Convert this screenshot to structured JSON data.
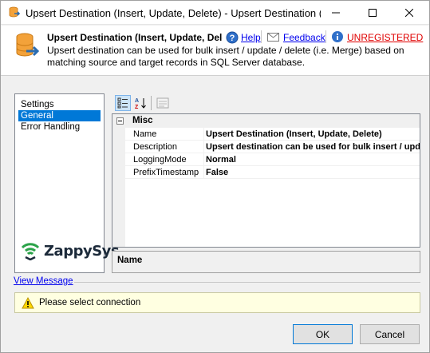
{
  "window": {
    "title": "Upsert Destination (Insert, Update, Delete) - Upsert Destination (Insert, Update, Delete)",
    "minimize_glyph": "—",
    "maximize_glyph": "☐",
    "close_glyph": "✕"
  },
  "header": {
    "title": "Upsert Destination (Insert, Update, Delete)",
    "help_label": "Help",
    "feedback_label": "Feedback",
    "unregistered_label": "UNREGISTERED",
    "description": "Upsert destination can be used for bulk insert / update / delete (i.e. Merge) based on matching source and target records in SQL Server database."
  },
  "nav": {
    "items": [
      {
        "label": "Settings",
        "selected": false
      },
      {
        "label": "General",
        "selected": true
      },
      {
        "label": "Error Handling",
        "selected": false
      }
    ],
    "logo_text": "ZappySys"
  },
  "property_grid": {
    "category": "Misc",
    "properties": [
      {
        "name": "Name",
        "value": "Upsert Destination (Insert, Update, Delete)"
      },
      {
        "name": "Description",
        "value": "Upsert destination can be used for bulk insert / update / delete (i.e. Merge) based on matching source and target records in SQL Server database."
      },
      {
        "name": "LoggingMode",
        "value": "Normal"
      },
      {
        "name": "PrefixTimestamp",
        "value": "False"
      }
    ],
    "selected_description_title": "Name"
  },
  "messages": {
    "view_message_label": "View Message",
    "text": "Please select connection"
  },
  "buttons": {
    "ok_label": "OK",
    "cancel_label": "Cancel"
  },
  "colors": {
    "selection": "#0078d7",
    "link": "#0000ee",
    "unregistered": "#e00000",
    "message_background": "#ffffe1"
  },
  "icons": {
    "title": "database-arrow-icon",
    "header": "database-arrow-icon",
    "help": "help-icon",
    "feedback": "mail-icon",
    "unregistered": "info-icon",
    "categorized": "categorized-view-icon",
    "sort_alpha": "sort-az-icon",
    "property_pages": "property-pages-icon",
    "warning": "warning-icon"
  }
}
